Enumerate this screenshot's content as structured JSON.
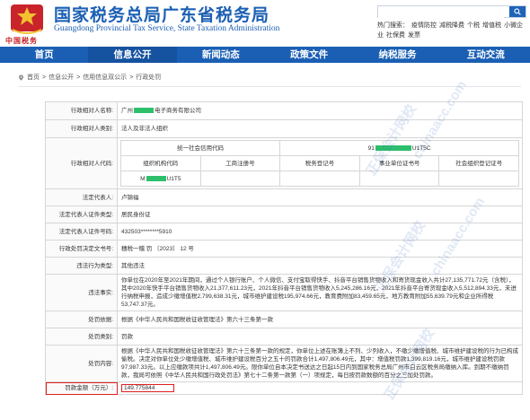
{
  "header": {
    "title_cn": "国家税务总局广东省税务局",
    "title_en": "Guangdong Provincial Tax Service, State Taxation Administration",
    "logo_mark": "中国税务",
    "search_placeholder": "",
    "hotwords": [
      "热门搜索：",
      "疫情防控",
      "减税降费",
      "个税",
      "增值税",
      "小微企业",
      "社保费",
      "发票"
    ]
  },
  "nav": {
    "items": [
      "首页",
      "信息公开",
      "新闻动态",
      "政策文件",
      "纳税服务",
      "互动交流"
    ],
    "active_index": 1,
    "active_color": "#1552a0",
    "bar_color": "#1a5fb4"
  },
  "breadcrumb": [
    "首页",
    "信息公开",
    "信用信息双公示",
    "行政处罚"
  ],
  "record": {
    "labels": {
      "counterparty": "行政相对人名称:",
      "category": "行政相对人类别:",
      "code": "行政相对人代码:",
      "legal_rep": "法定代表人:",
      "id_type": "法定代表人证件类型:",
      "id_no": "法定代表人证件号码:",
      "doc_no": "行政处罚决定文书号:",
      "violation_type": "违法行为类型:",
      "violation_facts": "违法事实:",
      "basis": "处罚依据:",
      "category_penalty": "处罚类别:",
      "content": "处罚内容:",
      "amount": "罚款金额（万元）:"
    },
    "counterparty_prefix": "广州",
    "counterparty_suffix": "电子商务有限公司",
    "category": "法人及非法人组织",
    "code_table": {
      "usc_label": "统一社会信用代码",
      "usc_prefix": "91",
      "usc_suffix": "U1T5C",
      "headers": [
        "组织机构代码",
        "工商注册号",
        "税务登记号",
        "事业单位证书号",
        "社会组织登记证号"
      ],
      "org_prefix": "M",
      "org_suffix": "U1T5"
    },
    "legal_rep": "卢锦福",
    "id_type": "居民身份证",
    "id_no": "432503********5910",
    "doc_no": "穗税一稽 罚 〔2023〕 12 号",
    "violation_type": "其他违法",
    "violation_facts": "你单位在2020年至2021年期间，通过个人银行账户、个人微信、支付宝取得快手、抖音平台销售货物收入和寄货现金收入共计27,135,771.72元（含税），其中2020年快手平台销售货物收入21,377,611.23元，2021年抖音平台销售货物收入5,245,286.16元，2021年抖音平台寄货现金收入5,512,894.33元，未进行纳税申报，造成少缴增值税2,799,638.31元，城市维护建设税195,974.66元，教育费附加83,459.65元，地方教育附加55,639.79元和企业所得税53,747.37元。",
    "basis": "根据《中华人民共和国税收征收管理法》第六十三条第一款",
    "penalty_category": "罚款",
    "content": "根据《中华人民共和国税收征收管理法》第六十三条第一款的规定，你单位上述在账簿上不列、少列收入，不缴少缴增值税、城市维护建设税的行为已构成偷税。决定对你单位处少缴增值税、城市维护建设税百分之五十的罚款合计1,497,806.49元，其中：增值税罚款1,399,819.16元，城市维护建设税罚款97,987.33元。以上应缴款项共计1,497,806.49元。限你单位自本决定书送达之日起15日内到国家税务总局广州市白云区税务局缴纳入库。到期不缴纳罚款，我局可依照《中华人民共和国行政处罚法》第七十二条第一款第（一）项规定，每日按罚款数额的百分之三加处罚款。",
    "amount": "149.775844",
    "highlight_color": "#e02020",
    "redaction_color": "#2ebf6d"
  },
  "watermark": {
    "texts": [
      "正保会计网校",
      "chinaacc.com",
      "正保会计网校",
      "chinaacc.com",
      "正保会计网校"
    ]
  }
}
